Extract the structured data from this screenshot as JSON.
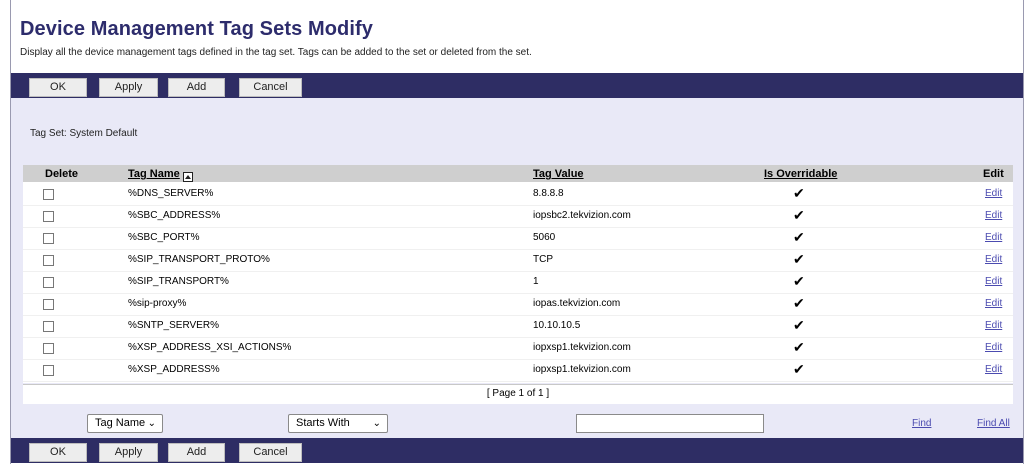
{
  "page": {
    "title": "Device Management Tag Sets Modify",
    "description": "Display all the device management tags defined in the tag set. Tags can be added to the set or deleted from the set."
  },
  "toolbar": {
    "ok_label": "OK",
    "apply_label": "Apply",
    "add_label": "Add",
    "cancel_label": "Cancel"
  },
  "tag_set": {
    "label": "Tag Set: System Default"
  },
  "table": {
    "columns": {
      "delete": "Delete",
      "tag_name": "Tag Name",
      "tag_value": "Tag Value",
      "is_overridable": "Is Overridable",
      "edit": "Edit"
    },
    "rows": [
      {
        "name": "%DNS_SERVER%",
        "value": "8.8.8.8",
        "overridable": "✔",
        "edit": "Edit"
      },
      {
        "name": "%SBC_ADDRESS%",
        "value": "iopsbc2.tekvizion.com",
        "overridable": "✔",
        "edit": "Edit"
      },
      {
        "name": "%SBC_PORT%",
        "value": "5060",
        "overridable": "✔",
        "edit": "Edit"
      },
      {
        "name": "%SIP_TRANSPORT_PROTO%",
        "value": "TCP",
        "overridable": "✔",
        "edit": "Edit"
      },
      {
        "name": "%SIP_TRANSPORT%",
        "value": "1",
        "overridable": "✔",
        "edit": "Edit"
      },
      {
        "name": "%sip-proxy%",
        "value": "iopas.tekvizion.com",
        "overridable": "✔",
        "edit": "Edit"
      },
      {
        "name": "%SNTP_SERVER%",
        "value": "10.10.10.5",
        "overridable": "✔",
        "edit": "Edit"
      },
      {
        "name": "%XSP_ADDRESS_XSI_ACTIONS%",
        "value": "iopxsp1.tekvizion.com",
        "overridable": "✔",
        "edit": "Edit"
      },
      {
        "name": "%XSP_ADDRESS%",
        "value": "iopxsp1.tekvizion.com",
        "overridable": "✔",
        "edit": "Edit"
      }
    ],
    "paging": "[ Page 1 of 1 ]"
  },
  "search": {
    "field_select": "Tag Name",
    "mode_select": "Starts With",
    "query_value": "",
    "find_label": "Find",
    "find_all_label": "Find All"
  },
  "icons": {
    "sort": "sort-ascending-icon",
    "chevron": "chevron-down-icon",
    "check": "checkmark-icon"
  },
  "colors": {
    "title": "#2d2c6c",
    "toolbar_bg": "#2e2d64",
    "panel_bg": "#e9e9f7",
    "header_bg": "#cfcfcf",
    "link": "#4b4bb0"
  }
}
